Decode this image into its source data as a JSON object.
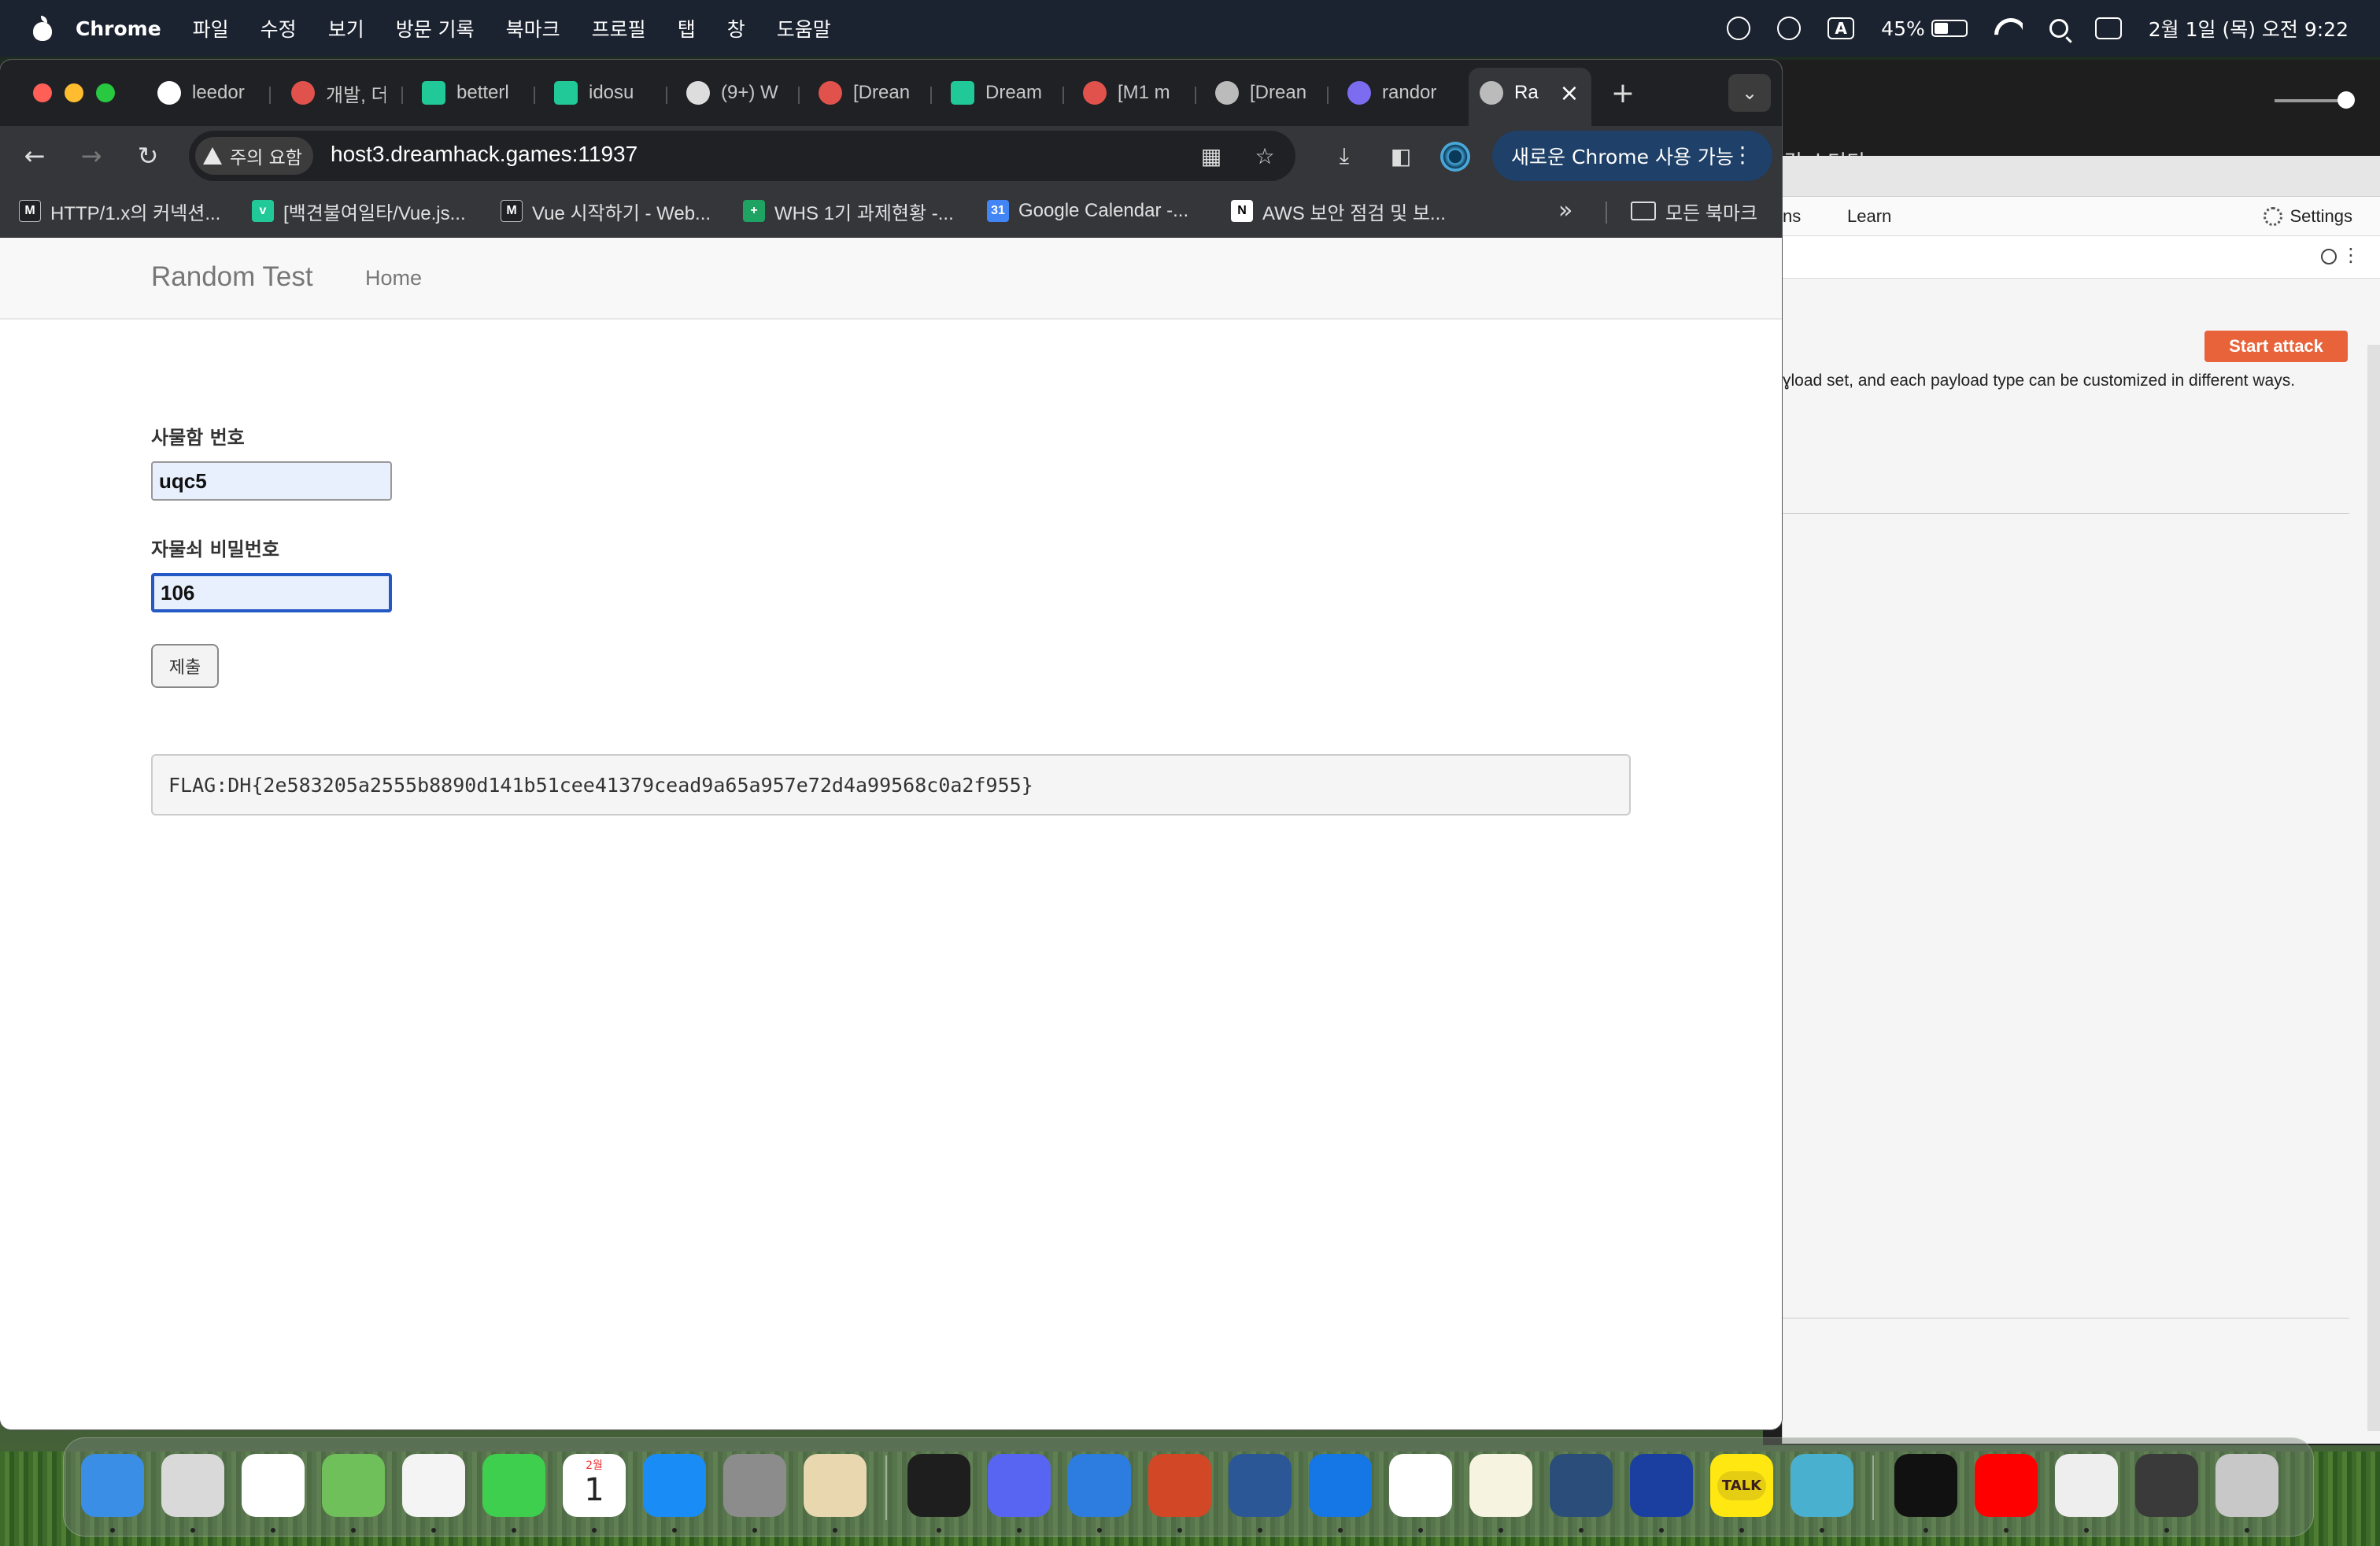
{
  "menubar": {
    "app_name": "Chrome",
    "items": [
      "파일",
      "수정",
      "보기",
      "방문 기록",
      "북마크",
      "프로필",
      "탭",
      "창",
      "도움말"
    ],
    "input_indicator": "A",
    "battery_percent": "45%",
    "battery_level": 0.45,
    "datetime": "2월 1일 (목) 오전 9:22"
  },
  "tabs": [
    {
      "label": "leedor",
      "favicon": "github-icon",
      "color": "#ffffff"
    },
    {
      "label": "개발, 더",
      "favicon": "dreamhack-icon",
      "color": "#e0524b"
    },
    {
      "label": "betterl",
      "favicon": "velog-icon",
      "color": "#20c997"
    },
    {
      "label": "idosu",
      "favicon": "velog-icon",
      "color": "#20c997"
    },
    {
      "label": "(9+) W",
      "favicon": "bird-icon",
      "color": "#dddddd"
    },
    {
      "label": "[Drean",
      "favicon": "dreamhack-icon",
      "color": "#e0524b"
    },
    {
      "label": "Dream",
      "favicon": "velog-icon",
      "color": "#20c997"
    },
    {
      "label": "[M1 m",
      "favicon": "dreamhack-icon",
      "color": "#e0524b"
    },
    {
      "label": "[Drean",
      "favicon": "globe-icon",
      "color": "#bbbbbb"
    },
    {
      "label": "randor",
      "favicon": "shield-icon",
      "color": "#7b6cf0"
    },
    {
      "label": "Ra",
      "favicon": "globe-icon",
      "color": "#bbbbbb",
      "active": true
    }
  ],
  "toolbar": {
    "security_warning": "주의 요함",
    "url": "host3.dreamhack.games:11937",
    "update_button": "새로운 Chrome 사용 가능"
  },
  "bookmarks": [
    {
      "label": "HTTP/1.x의 커넥션...",
      "icon": "m-logo-icon"
    },
    {
      "label": "[백견불여일타/Vue.js...",
      "icon": "velog-icon"
    },
    {
      "label": "Vue 시작하기 - Web...",
      "icon": "m-logo-icon"
    },
    {
      "label": "WHS 1기 과제현황 -...",
      "icon": "sheets-icon"
    },
    {
      "label": "Google Calendar -...",
      "icon": "calendar-icon"
    },
    {
      "label": "AWS 보안 점검 및 보...",
      "icon": "notion-icon"
    }
  ],
  "bookmarks_folder": "모든 북마크",
  "page": {
    "brand": "Random Test",
    "nav_home": "Home",
    "locker_label": "사물함 번호",
    "locker_value": "uqc5",
    "password_label": "자물쇠 비밀번호",
    "password_value": "106",
    "submit_label": "제출",
    "flag": "FLAG:DH{2e583205a2555b8890d141b51cee41379cead9a65a957e72d4a99568c0a2f955}"
  },
  "burp": {
    "menu_partial": "ns",
    "learn": "Learn",
    "settings": "Settings",
    "start_attack": "Start attack",
    "description": "ɣload set, and each payload type can be customized in different ways.",
    "korean_partial": "킹 스터디"
  },
  "dock": [
    {
      "name": "finder-icon",
      "color": "#3a8ee6"
    },
    {
      "name": "launchpad-icon",
      "color": "#d9d9d9"
    },
    {
      "name": "chrome-icon",
      "color": "#ffffff"
    },
    {
      "name": "maps-icon",
      "color": "#6fbf5a"
    },
    {
      "name": "photos-icon",
      "color": "#f4f4f4"
    },
    {
      "name": "facetime-icon",
      "color": "#3ecf4f"
    },
    {
      "name": "calendar-icon",
      "color": "#ffffff"
    },
    {
      "name": "app-store-icon",
      "color": "#1a8cf5"
    },
    {
      "name": "system-settings-icon",
      "color": "#8c8c8c"
    },
    {
      "name": "recycle-icon",
      "color": "#e9d7b0"
    },
    {
      "name": "terminal-icon",
      "color": "#1e1e1e"
    },
    {
      "name": "discord-icon",
      "color": "#5865f2"
    },
    {
      "name": "xcode-tools-icon",
      "color": "#2d7de0"
    },
    {
      "name": "powerpoint-icon",
      "color": "#d24726"
    },
    {
      "name": "word-icon",
      "color": "#2b5797"
    },
    {
      "name": "xcode-icon",
      "color": "#1576e6"
    },
    {
      "name": "instruments-icon",
      "color": "#ffffff"
    },
    {
      "name": "notes-icon",
      "color": "#f6f3e0"
    },
    {
      "name": "wireshark-icon",
      "color": "#2a4d7a"
    },
    {
      "name": "proxy-icon",
      "color": "#1a3fa0"
    },
    {
      "name": "kakaotalk-icon",
      "color": "#ffe812"
    },
    {
      "name": "reeder-icon",
      "color": "#4ab0d0"
    },
    {
      "name": "netflix-icon",
      "color": "#111111"
    },
    {
      "name": "youtube-icon",
      "color": "#ff0000"
    },
    {
      "name": "phone-mirror-icon",
      "color": "#eeeeee"
    },
    {
      "name": "screen-window-icon",
      "color": "#3a3a3a"
    },
    {
      "name": "trash-icon",
      "color": "#c8c8c8"
    }
  ],
  "dock_labels": {
    "calendar_month": "2월",
    "calendar_day": "1",
    "kakao": "TALK"
  }
}
